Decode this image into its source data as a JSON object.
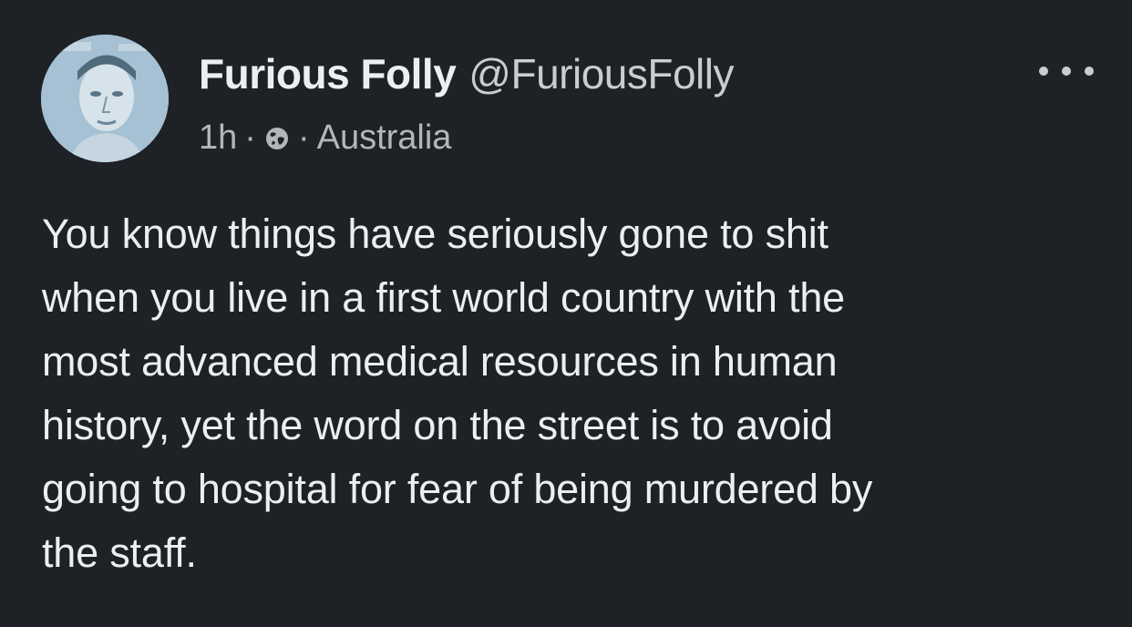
{
  "post": {
    "author_name": "Furious Folly",
    "author_handle": "@FuriousFolly",
    "time": "1h",
    "separator": "·",
    "location": "Australia",
    "visibility_icon": "globe-icon",
    "more_icon": "more-options-icon",
    "body_lines": [
      "You know things have seriously gone to shit",
      "when you live in a first world country with the",
      "most advanced medical resources in human",
      "history, yet the word on the street is to avoid",
      "going to hospital for fear of being murdered by",
      "the staff."
    ]
  },
  "colors": {
    "background": "#1e2125",
    "text_primary": "#eceef0",
    "text_secondary": "#b3b7bc",
    "avatar_bg": "#a9c3d4"
  }
}
